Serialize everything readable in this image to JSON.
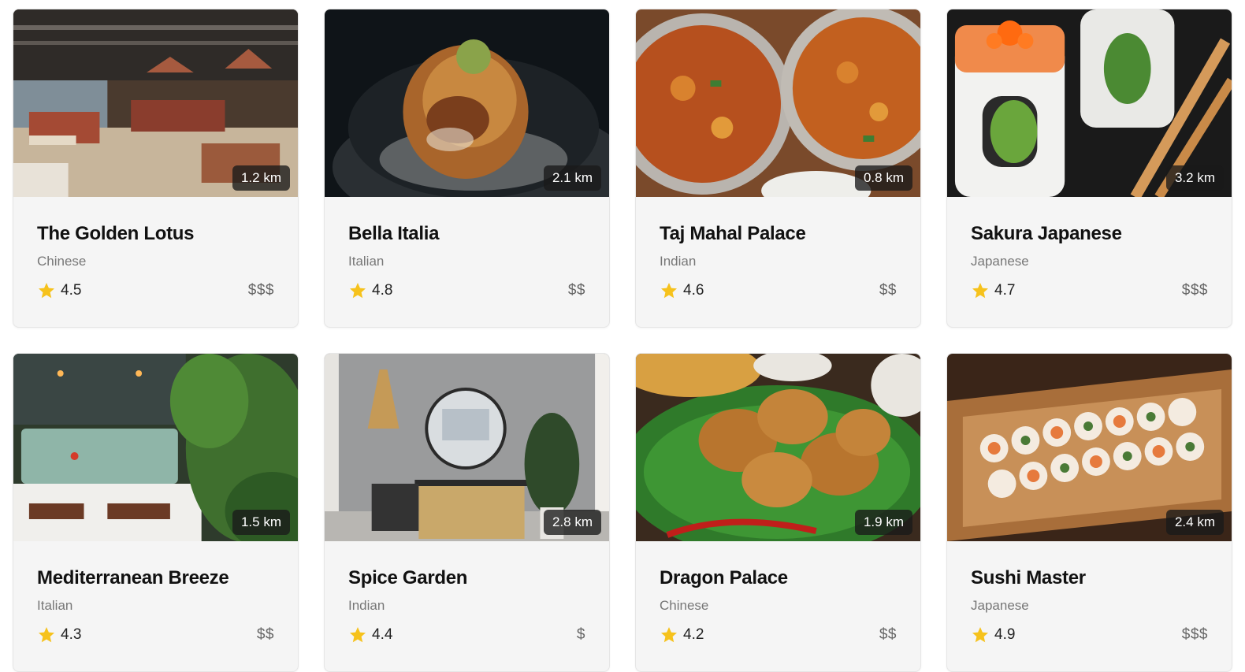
{
  "colors": {
    "card_bg": "#f5f5f5",
    "star": "#f6c21c",
    "badge_bg": "#191919"
  },
  "restaurants": [
    {
      "name": "The Golden Lotus",
      "cuisine": "Chinese",
      "rating": "4.5",
      "price": "$$$",
      "distance": "1.2 km",
      "image": "restaurant-interior-photo"
    },
    {
      "name": "Bella Italia",
      "cuisine": "Italian",
      "rating": "4.8",
      "price": "$$",
      "distance": "2.1 km",
      "image": "pasta-dish-photo"
    },
    {
      "name": "Taj Mahal Palace",
      "cuisine": "Indian",
      "rating": "4.6",
      "price": "$$",
      "distance": "0.8 km",
      "image": "curry-bowls-photo"
    },
    {
      "name": "Sakura Japanese",
      "cuisine": "Japanese",
      "rating": "4.7",
      "price": "$$$",
      "distance": "3.2 km",
      "image": "sushi-roll-photo"
    },
    {
      "name": "Mediterranean Breeze",
      "cuisine": "Italian",
      "rating": "4.3",
      "price": "$$",
      "distance": "1.5 km",
      "image": "green-dining-room-photo"
    },
    {
      "name": "Spice Garden",
      "cuisine": "Indian",
      "rating": "4.4",
      "price": "$",
      "distance": "2.8 km",
      "image": "interior-with-mirror-photo"
    },
    {
      "name": "Dragon Palace",
      "cuisine": "Chinese",
      "rating": "4.2",
      "price": "$$",
      "distance": "1.9 km",
      "image": "fried-chicken-photo"
    },
    {
      "name": "Sushi Master",
      "cuisine": "Japanese",
      "rating": "4.9",
      "price": "$$$",
      "distance": "2.4 km",
      "image": "sushi-boat-photo"
    }
  ]
}
